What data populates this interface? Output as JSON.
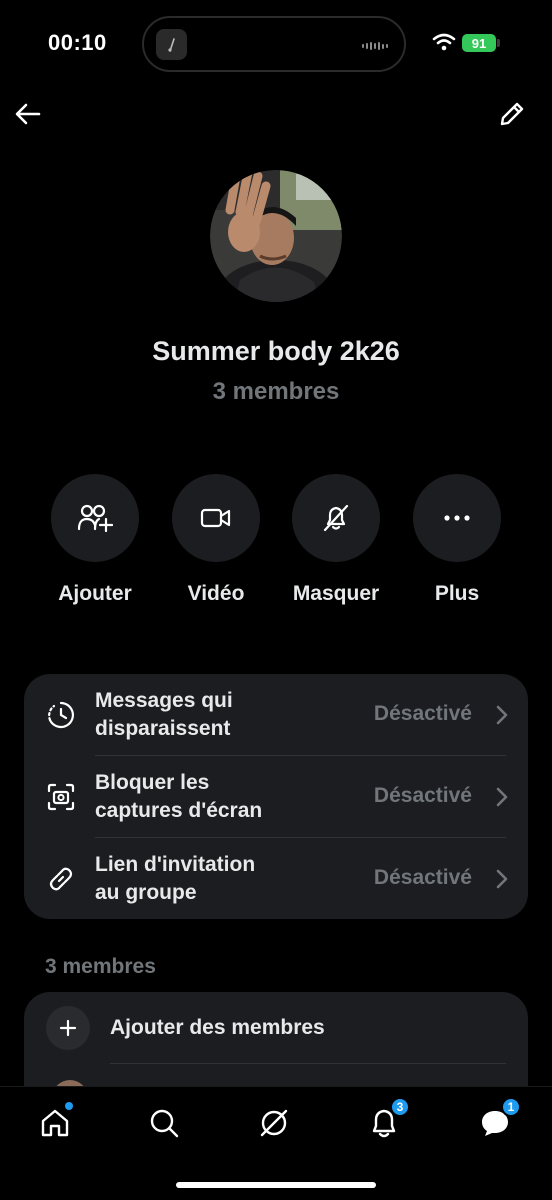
{
  "status_bar": {
    "time": "00:10",
    "battery": "91"
  },
  "header": {
    "back_icon": "arrow-left-icon",
    "edit_icon": "pencil-icon"
  },
  "group": {
    "name": "Summer body 2k26",
    "member_count": "3 membres"
  },
  "actions": [
    {
      "label": "Ajouter",
      "icon": "add-people-icon"
    },
    {
      "label": "Vidéo",
      "icon": "video-camera-icon"
    },
    {
      "label": "Masquer",
      "icon": "bell-off-icon"
    },
    {
      "label": "Plus",
      "icon": "more-dots-icon"
    }
  ],
  "settings": [
    {
      "title_line1": "Messages qui",
      "title_line2": "disparaissent",
      "status": "Désactivé",
      "icon": "timer-icon"
    },
    {
      "title_line1": "Bloquer les",
      "title_line2": "captures d'écran",
      "status": "Désactivé",
      "icon": "screenshot-icon"
    },
    {
      "title_line1": "Lien d'invitation",
      "title_line2": "au groupe",
      "status": "Désactivé",
      "icon": "link-icon"
    }
  ],
  "members": {
    "section_label": "3 membres",
    "add_label": "Ajouter des membres"
  },
  "tabbar": {
    "items": [
      "home-icon",
      "search-icon",
      "grok-icon",
      "notifications-icon",
      "messages-icon"
    ],
    "notifications_badge": "3",
    "messages_badge": "1"
  },
  "colors": {
    "accent": "#1d9bf0",
    "card": "#1c1d20",
    "secondary_text": "#71767b"
  }
}
